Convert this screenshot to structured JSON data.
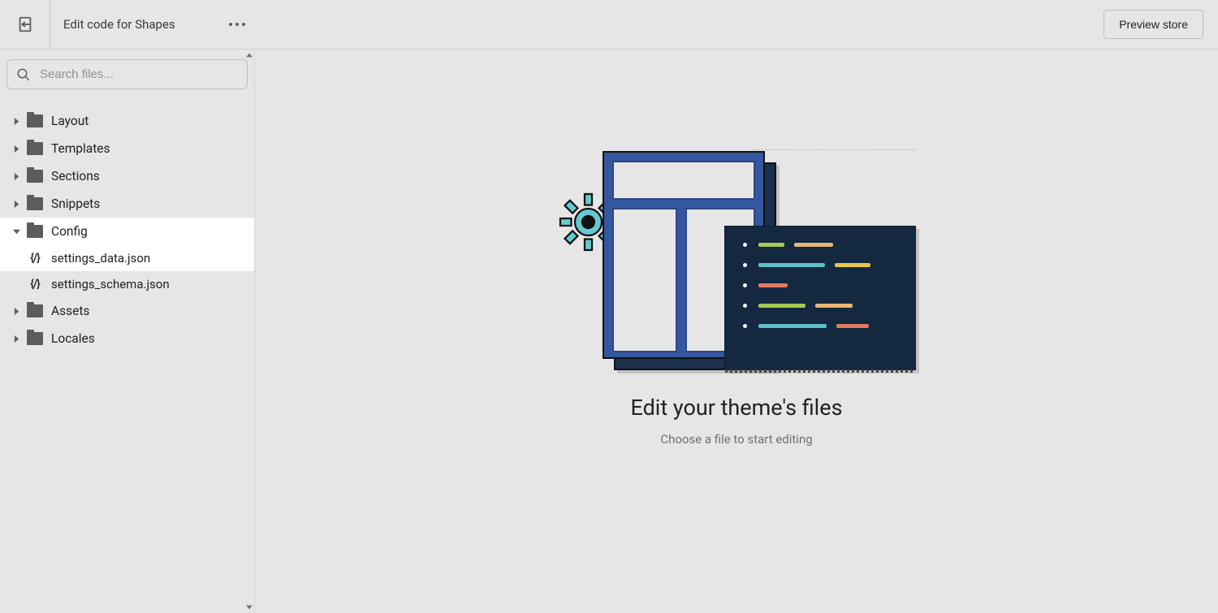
{
  "header": {
    "title": "Edit code for Shapes",
    "preview_label": "Preview store"
  },
  "sidebar": {
    "search_placeholder": "Search files...",
    "folders": [
      {
        "label": "Layout",
        "expanded": false
      },
      {
        "label": "Templates",
        "expanded": false
      },
      {
        "label": "Sections",
        "expanded": false
      },
      {
        "label": "Snippets",
        "expanded": false
      },
      {
        "label": "Config",
        "expanded": true
      },
      {
        "label": "Assets",
        "expanded": false
      },
      {
        "label": "Locales",
        "expanded": false
      }
    ],
    "config_files": [
      {
        "label": "settings_data.json",
        "highlighted": true
      },
      {
        "label": "settings_schema.json",
        "highlighted": false
      }
    ]
  },
  "main": {
    "heading": "Edit your theme's files",
    "subheading": "Choose a file to start editing"
  }
}
